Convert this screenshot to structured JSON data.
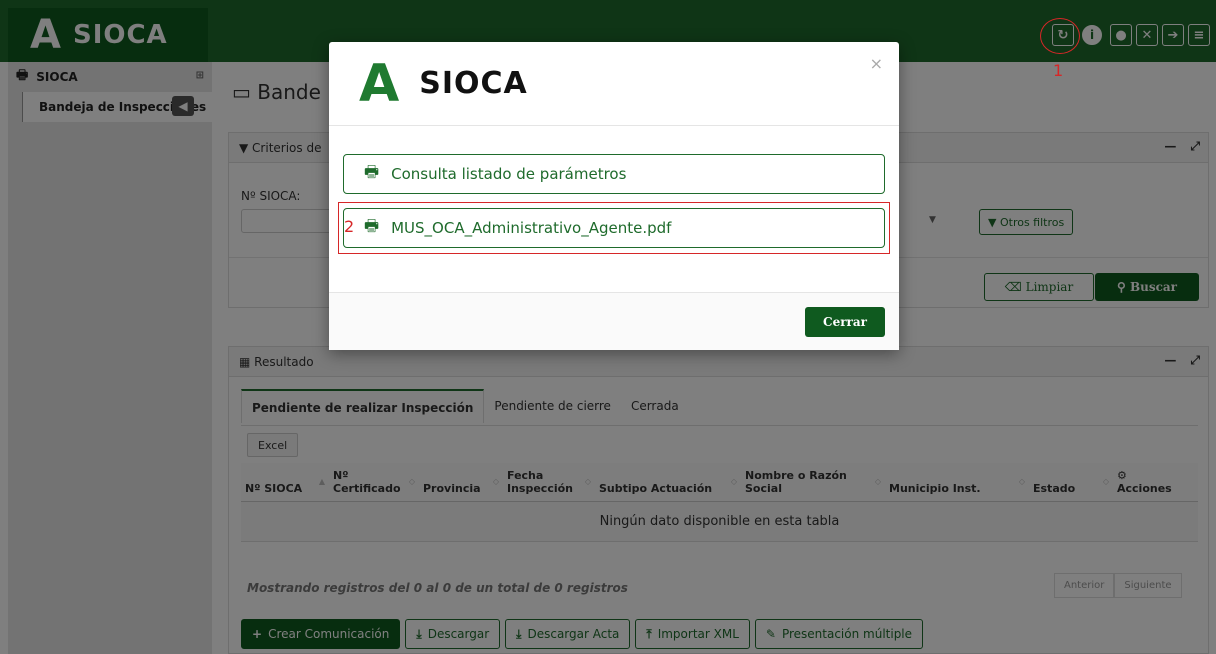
{
  "app": {
    "name": "SIOCA",
    "logo_glyph": "A"
  },
  "topbar": {
    "icons": [
      "refresh-icon",
      "info-icon",
      "user-icon",
      "expand-icon",
      "logout-icon",
      "menu-icon"
    ]
  },
  "sidebar": {
    "section": "SIOCA",
    "items": [
      {
        "label": "Bandeja de Inspecciones"
      }
    ]
  },
  "page": {
    "title": "Bande"
  },
  "criterios": {
    "title": "Criterios de",
    "field_label": "Nº SIOCA:",
    "otros_filtros": "Otros filtros",
    "limpiar": "Limpiar",
    "buscar": "Buscar"
  },
  "resultado": {
    "title": "Resultado",
    "tabs": [
      "Pendiente de realizar Inspección",
      "Pendiente de cierre",
      "Cerrada"
    ],
    "excel": "Excel",
    "columns": [
      "Nº SIOCA",
      "Nº Certificado",
      "Provincia",
      "Fecha Inspección",
      "Subtipo Actuación",
      "Nombre o Razón Social",
      "Municipio Inst.",
      "Estado",
      "Acciones"
    ],
    "empty": "Ningún dato disponible en esta tabla",
    "showing": "Mostrando registros del 0 al 0 de un total de 0 registros",
    "prev": "Anterior",
    "next": "Siguiente",
    "actions": [
      "Crear Comunicación",
      "Descargar",
      "Descargar Acta",
      "Importar XML",
      "Presentación múltiple"
    ]
  },
  "modal": {
    "title": "SIOCA",
    "option1": "Consulta listado de parámetros",
    "option2": "MUS_OCA_Administrativo_Agente.pdf",
    "close": "Cerrar"
  },
  "annotations": {
    "mark1": "1",
    "mark2": "2"
  },
  "colors": {
    "brand": "#1f6b2c",
    "brand_dark": "#0f5a1f",
    "annotation": "#d62728"
  }
}
